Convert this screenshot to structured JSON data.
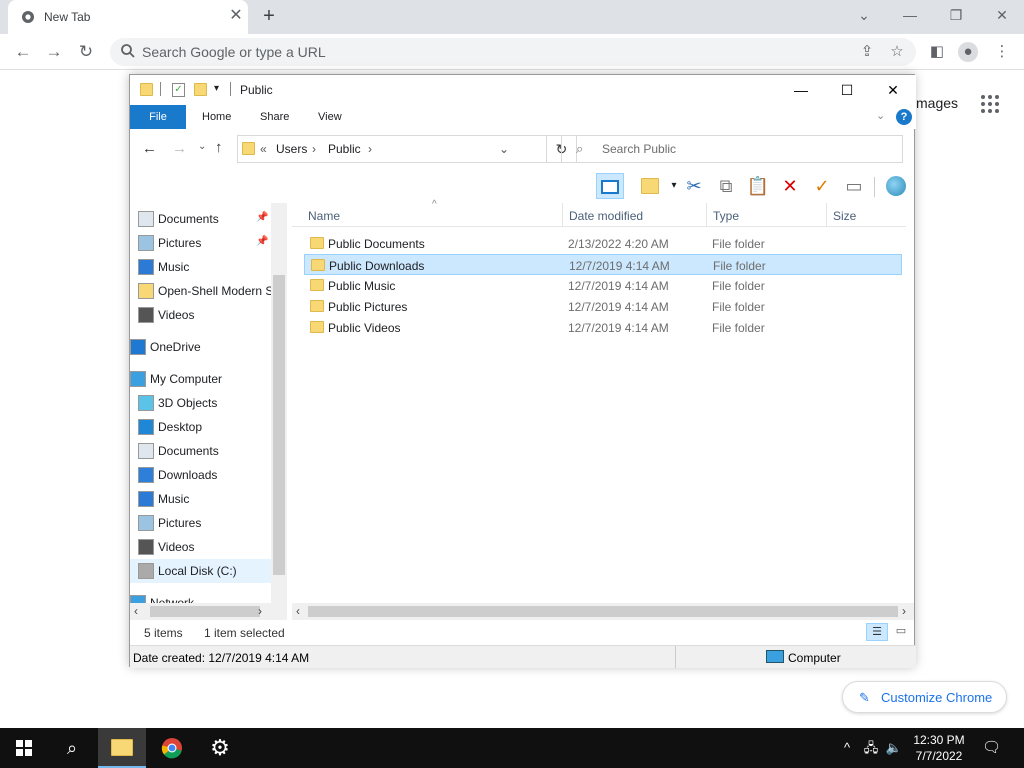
{
  "chrome": {
    "tab_title": "New Tab",
    "omnibox_placeholder": "Search Google or type a URL",
    "images_link": "mages",
    "customize_label": "Customize Chrome"
  },
  "explorer": {
    "title": "Public",
    "ribbon_tabs": [
      "File",
      "Home",
      "Share",
      "View"
    ],
    "breadcrumb": [
      "Users",
      "Public"
    ],
    "breadcrumb_prefix": "«",
    "search_placeholder": "Search Public",
    "nav_items": [
      {
        "label": "Documents",
        "icon": "documents-icon",
        "pinned": true
      },
      {
        "label": "Pictures",
        "icon": "pictures-icon",
        "pinned": true
      },
      {
        "label": "Music",
        "icon": "music-icon",
        "pinned": false
      },
      {
        "label": "Open-Shell Modern S",
        "icon": "folder-icon",
        "pinned": false
      },
      {
        "label": "Videos",
        "icon": "videos-icon",
        "pinned": false
      },
      {
        "label": "OneDrive",
        "icon": "onedrive-icon",
        "pinned": false
      },
      {
        "label": "My Computer",
        "icon": "computer-icon",
        "pinned": false
      },
      {
        "label": "3D Objects",
        "icon": "3d-objects-icon",
        "pinned": false
      },
      {
        "label": "Desktop",
        "icon": "desktop-icon",
        "pinned": false
      },
      {
        "label": "Documents",
        "icon": "documents-icon",
        "pinned": false
      },
      {
        "label": "Downloads",
        "icon": "downloads-icon",
        "pinned": false
      },
      {
        "label": "Music",
        "icon": "music-icon",
        "pinned": false
      },
      {
        "label": "Pictures",
        "icon": "pictures-icon",
        "pinned": false
      },
      {
        "label": "Videos",
        "icon": "videos-icon",
        "pinned": false
      },
      {
        "label": "Local Disk (C:)",
        "icon": "drive-icon",
        "pinned": false
      },
      {
        "label": "Network",
        "icon": "network-icon",
        "pinned": false
      }
    ],
    "columns": [
      "Name",
      "Date modified",
      "Type",
      "Size"
    ],
    "files": [
      {
        "name": "Public Documents",
        "date": "2/13/2022 4:20 AM",
        "type": "File folder",
        "selected": false
      },
      {
        "name": "Public Downloads",
        "date": "12/7/2019 4:14 AM",
        "type": "File folder",
        "selected": true
      },
      {
        "name": "Public Music",
        "date": "12/7/2019 4:14 AM",
        "type": "File folder",
        "selected": false
      },
      {
        "name": "Public Pictures",
        "date": "12/7/2019 4:14 AM",
        "type": "File folder",
        "selected": false
      },
      {
        "name": "Public Videos",
        "date": "12/7/2019 4:14 AM",
        "type": "File folder",
        "selected": false
      }
    ],
    "status_items": "5 items",
    "status_selected": "1 item selected",
    "details_created": "Date created: 12/7/2019 4:14 AM",
    "details_location": "Computer"
  },
  "taskbar": {
    "time": "12:30 PM",
    "date": "7/7/2022"
  },
  "colors": {
    "accent": "#1979ca",
    "selection": "#cce8ff",
    "taskbar": "#101010"
  }
}
